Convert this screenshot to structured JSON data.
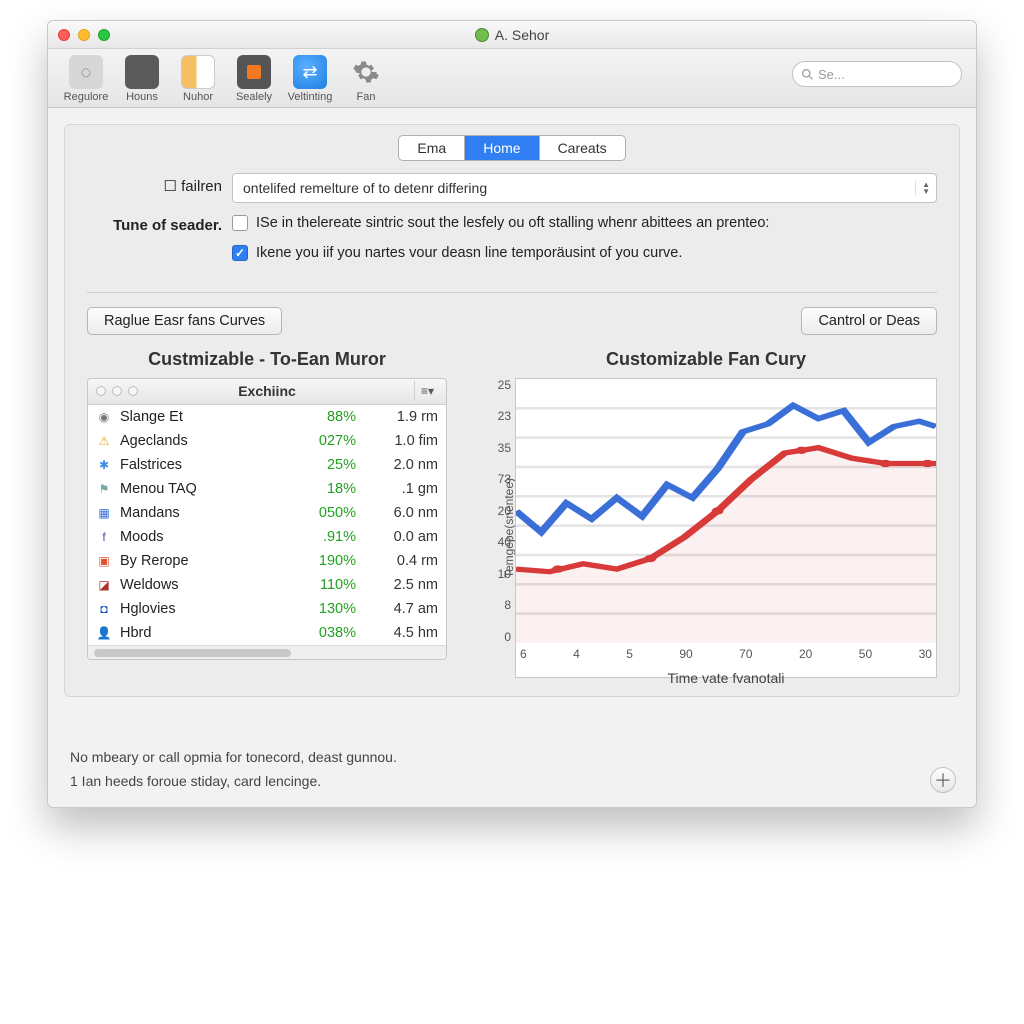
{
  "window": {
    "title": "A. Sehor"
  },
  "toolbar": {
    "items": [
      {
        "label": "Regulore"
      },
      {
        "label": "Houns"
      },
      {
        "label": "Nuhor"
      },
      {
        "label": "Sealely"
      },
      {
        "label": "Veltinting"
      },
      {
        "label": "Fan"
      }
    ],
    "search_placeholder": "Se..."
  },
  "tabs": {
    "items": [
      "Ema",
      "Home",
      "Careats"
    ],
    "active": 1
  },
  "form": {
    "label_failren": "failren",
    "combo_failren": "ontelifed remelture of to detenr differing",
    "label_seader": "Tune of seader.",
    "check1_text": "ISe in thelereate sintric sout the lesfely ou oft stalling whenr abittees an prenteo:",
    "check1_checked": false,
    "check2_text": "Ikene you iif you nartes vour deasn line temporäusint of you curve.",
    "check2_checked": true
  },
  "buttons": {
    "left": "Raglue Easr fans Curves",
    "right": "Cantrol or Deas"
  },
  "left_panel": {
    "title": "Custmizable - To-Ean Muror",
    "header": "Exchiinc",
    "rows": [
      {
        "icon": "◉",
        "name": "Slange Et",
        "pct": "88%",
        "val": "1.9 rm"
      },
      {
        "icon": "⚠",
        "name": "Ageclands",
        "pct": "027%",
        "val": "1.0 fim"
      },
      {
        "icon": "✱",
        "name": "Falstrices",
        "pct": "25%",
        "val": "2.0 nm"
      },
      {
        "icon": "⚑",
        "name": "Menou TAQ",
        "pct": "18%",
        "val": ".1 gm"
      },
      {
        "icon": "▦",
        "name": "Mandans",
        "pct": "050%",
        "val": "6.0 nm"
      },
      {
        "icon": "f",
        "name": "Moods",
        "pct": ".91%",
        "val": "0.0 am"
      },
      {
        "icon": "▣",
        "name": "By Rerope",
        "pct": "190%",
        "val": "0.4 rm"
      },
      {
        "icon": "◪",
        "name": "Weldows",
        "pct": "110%",
        "val": "2.5 nm"
      },
      {
        "icon": "◘",
        "name": "Hglovies",
        "pct": "130%",
        "val": "4.7 am"
      },
      {
        "icon": "👤",
        "name": "Hbrd",
        "pct": "038%",
        "val": "4.5 hm"
      }
    ]
  },
  "chart_title": "Customizable Fan Cury",
  "chart_data": {
    "type": "line",
    "xlabel": "Time vate fvanotali",
    "ylabel": "Temgepe(snentee)",
    "x_ticks": [
      "6",
      "4",
      "5",
      "90",
      "70",
      "20",
      "50",
      "30"
    ],
    "y_ticks": [
      "25",
      "23",
      "35",
      "73",
      "20",
      "40",
      "10",
      "8",
      "0"
    ],
    "series": [
      {
        "name": "blue",
        "color": "#3a6fd8",
        "points": [
          [
            0,
            0.5
          ],
          [
            0.06,
            0.42
          ],
          [
            0.12,
            0.53
          ],
          [
            0.18,
            0.47
          ],
          [
            0.24,
            0.55
          ],
          [
            0.3,
            0.48
          ],
          [
            0.36,
            0.6
          ],
          [
            0.42,
            0.55
          ],
          [
            0.48,
            0.66
          ],
          [
            0.54,
            0.8
          ],
          [
            0.6,
            0.83
          ],
          [
            0.66,
            0.9
          ],
          [
            0.72,
            0.85
          ],
          [
            0.78,
            0.88
          ],
          [
            0.84,
            0.76
          ],
          [
            0.9,
            0.82
          ],
          [
            0.96,
            0.84
          ],
          [
            1.0,
            0.82
          ]
        ]
      },
      {
        "name": "red",
        "color": "#d83a3a",
        "points": [
          [
            0,
            0.28
          ],
          [
            0.08,
            0.27
          ],
          [
            0.16,
            0.3
          ],
          [
            0.24,
            0.28
          ],
          [
            0.32,
            0.32
          ],
          [
            0.4,
            0.4
          ],
          [
            0.48,
            0.5
          ],
          [
            0.56,
            0.62
          ],
          [
            0.64,
            0.72
          ],
          [
            0.72,
            0.74
          ],
          [
            0.8,
            0.7
          ],
          [
            0.88,
            0.68
          ],
          [
            0.96,
            0.68
          ],
          [
            1.0,
            0.68
          ]
        ],
        "dots": [
          [
            0.1,
            0.28
          ],
          [
            0.32,
            0.32
          ],
          [
            0.48,
            0.5
          ],
          [
            0.68,
            0.73
          ],
          [
            0.88,
            0.68
          ],
          [
            0.98,
            0.68
          ]
        ]
      }
    ]
  },
  "footer": {
    "line1": "No mbeary or call opmia for tonecord, deast gunnou.",
    "line2": "1 Ian heeds foroue stiday, card lencinge."
  }
}
